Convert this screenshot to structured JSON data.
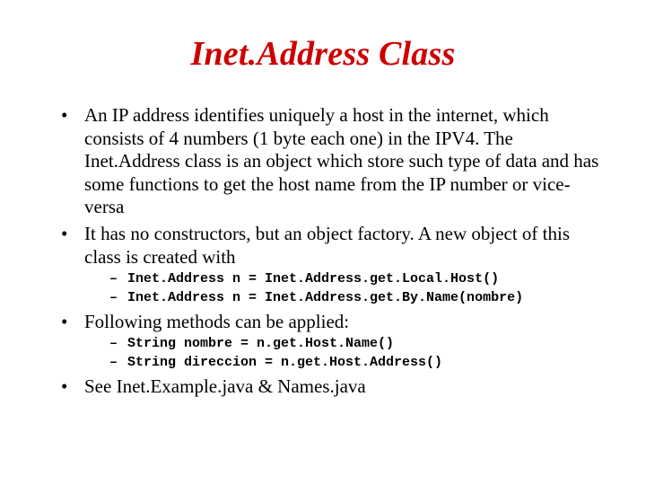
{
  "title": "Inet.Address Class",
  "bullets": {
    "b1": "An IP address identifies uniquely a host in the internet, which consists of 4 numbers (1 byte each one) in the IPV4. The Inet.Address class is an object which store such type of data and has some functions to get the host name from the IP number or vice-versa",
    "b2": "It has no constructors, but an object factory. A new object of this class is created with",
    "b2_sub1": "Inet.Address n = Inet.Address.get.Local.Host()",
    "b2_sub2": "Inet.Address n = Inet.Address.get.By.Name(nombre)",
    "b3": "Following methods can be applied:",
    "b3_sub1": "String nombre = n.get.Host.Name()",
    "b3_sub2": "String direccion = n.get.Host.Address()",
    "b4": "See Inet.Example.java & Names.java"
  }
}
